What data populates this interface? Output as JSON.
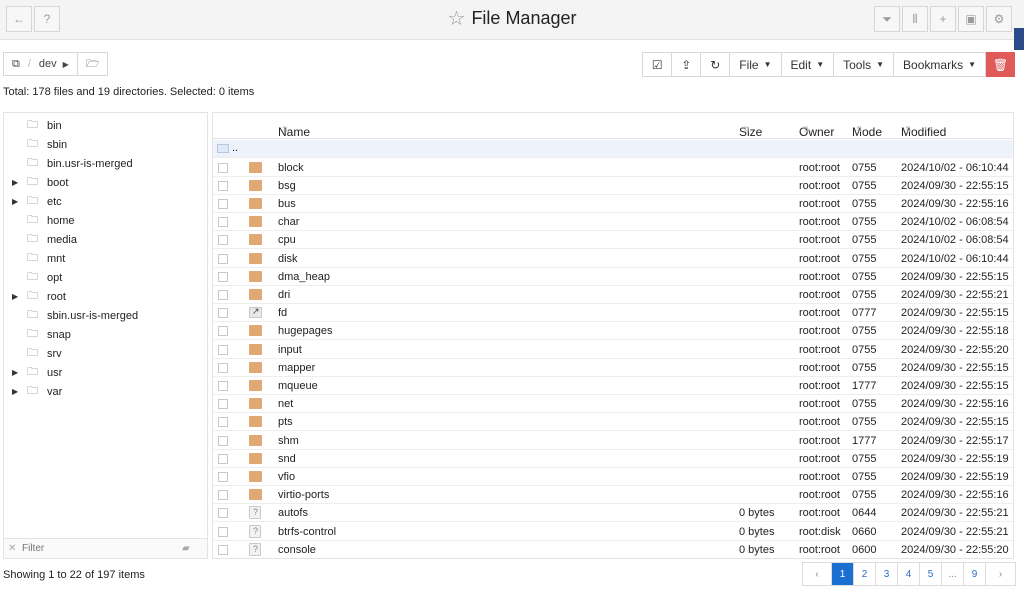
{
  "window": {
    "title": "File Manager"
  },
  "toolbar": {
    "breadcrumb": [
      "dev"
    ],
    "menus": [
      "File",
      "Edit",
      "Tools",
      "Bookmarks"
    ]
  },
  "summary": "Total: 178 files and 19 directories. Selected: 0 items",
  "tree": [
    {
      "label": "bin",
      "expandable": false
    },
    {
      "label": "sbin",
      "expandable": false
    },
    {
      "label": "bin.usr-is-merged",
      "expandable": false
    },
    {
      "label": "boot",
      "expandable": true
    },
    {
      "label": "etc",
      "expandable": true
    },
    {
      "label": "home",
      "expandable": false
    },
    {
      "label": "media",
      "expandable": false
    },
    {
      "label": "mnt",
      "expandable": false
    },
    {
      "label": "opt",
      "expandable": false
    },
    {
      "label": "root",
      "expandable": true
    },
    {
      "label": "sbin.usr-is-merged",
      "expandable": false
    },
    {
      "label": "snap",
      "expandable": false
    },
    {
      "label": "srv",
      "expandable": false
    },
    {
      "label": "usr",
      "expandable": true
    },
    {
      "label": "var",
      "expandable": true
    }
  ],
  "filter": {
    "placeholder": "Filter"
  },
  "grid": {
    "columns": [
      "Name",
      "Size",
      "Owner",
      "Mode",
      "Modified"
    ],
    "parent_row": "..",
    "rows": [
      {
        "name": "block",
        "type": "folder",
        "size": "",
        "owner": "root:root",
        "mode": "0755",
        "modified": "2024/10/02 - 06:10:44"
      },
      {
        "name": "bsg",
        "type": "folder",
        "size": "",
        "owner": "root:root",
        "mode": "0755",
        "modified": "2024/09/30 - 22:55:15"
      },
      {
        "name": "bus",
        "type": "folder",
        "size": "",
        "owner": "root:root",
        "mode": "0755",
        "modified": "2024/09/30 - 22:55:16"
      },
      {
        "name": "char",
        "type": "folder",
        "size": "",
        "owner": "root:root",
        "mode": "0755",
        "modified": "2024/10/02 - 06:08:54"
      },
      {
        "name": "cpu",
        "type": "folder",
        "size": "",
        "owner": "root:root",
        "mode": "0755",
        "modified": "2024/10/02 - 06:08:54"
      },
      {
        "name": "disk",
        "type": "folder",
        "size": "",
        "owner": "root:root",
        "mode": "0755",
        "modified": "2024/10/02 - 06:10:44"
      },
      {
        "name": "dma_heap",
        "type": "folder",
        "size": "",
        "owner": "root:root",
        "mode": "0755",
        "modified": "2024/09/30 - 22:55:15"
      },
      {
        "name": "dri",
        "type": "folder",
        "size": "",
        "owner": "root:root",
        "mode": "0755",
        "modified": "2024/09/30 - 22:55:21"
      },
      {
        "name": "fd",
        "type": "link",
        "size": "",
        "owner": "root:root",
        "mode": "0777",
        "modified": "2024/09/30 - 22:55:15"
      },
      {
        "name": "hugepages",
        "type": "folder",
        "size": "",
        "owner": "root:root",
        "mode": "0755",
        "modified": "2024/09/30 - 22:55:18"
      },
      {
        "name": "input",
        "type": "folder",
        "size": "",
        "owner": "root:root",
        "mode": "0755",
        "modified": "2024/09/30 - 22:55:20"
      },
      {
        "name": "mapper",
        "type": "folder",
        "size": "",
        "owner": "root:root",
        "mode": "0755",
        "modified": "2024/09/30 - 22:55:15"
      },
      {
        "name": "mqueue",
        "type": "folder",
        "size": "",
        "owner": "root:root",
        "mode": "1777",
        "modified": "2024/09/30 - 22:55:15"
      },
      {
        "name": "net",
        "type": "folder",
        "size": "",
        "owner": "root:root",
        "mode": "0755",
        "modified": "2024/09/30 - 22:55:16"
      },
      {
        "name": "pts",
        "type": "folder",
        "size": "",
        "owner": "root:root",
        "mode": "0755",
        "modified": "2024/09/30 - 22:55:15"
      },
      {
        "name": "shm",
        "type": "folder",
        "size": "",
        "owner": "root:root",
        "mode": "1777",
        "modified": "2024/09/30 - 22:55:17"
      },
      {
        "name": "snd",
        "type": "folder",
        "size": "",
        "owner": "root:root",
        "mode": "0755",
        "modified": "2024/09/30 - 22:55:19"
      },
      {
        "name": "vfio",
        "type": "folder",
        "size": "",
        "owner": "root:root",
        "mode": "0755",
        "modified": "2024/09/30 - 22:55:19"
      },
      {
        "name": "virtio-ports",
        "type": "folder",
        "size": "",
        "owner": "root:root",
        "mode": "0755",
        "modified": "2024/09/30 - 22:55:16"
      },
      {
        "name": "autofs",
        "type": "unknown",
        "size": "0 bytes",
        "owner": "root:root",
        "mode": "0644",
        "modified": "2024/09/30 - 22:55:21"
      },
      {
        "name": "btrfs-control",
        "type": "unknown",
        "size": "0 bytes",
        "owner": "root:disk",
        "mode": "0660",
        "modified": "2024/09/30 - 22:55:21"
      },
      {
        "name": "console",
        "type": "unknown",
        "size": "0 bytes",
        "owner": "root:root",
        "mode": "0600",
        "modified": "2024/09/30 - 22:55:20"
      }
    ]
  },
  "footer": {
    "status": "Showing 1 to 22 of 197 items",
    "pages": [
      "1",
      "2",
      "3",
      "4",
      "5",
      "...",
      "9"
    ],
    "active_page": "1"
  }
}
